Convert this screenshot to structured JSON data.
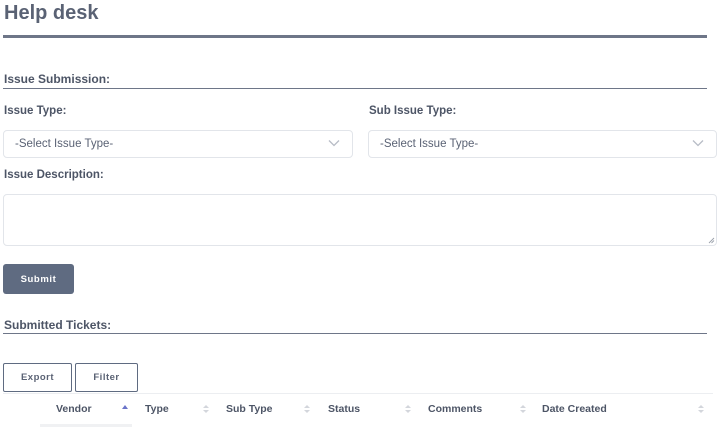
{
  "page": {
    "title": "Help desk"
  },
  "issue_submission": {
    "heading": "Issue Submission:",
    "issue_type": {
      "label": "Issue Type:",
      "selected": "-Select Issue Type-"
    },
    "sub_issue_type": {
      "label": "Sub Issue Type:",
      "selected": "-Select Issue Type-"
    },
    "description": {
      "label": "Issue Description:",
      "value": ""
    },
    "submit_label": "Submit"
  },
  "submitted_tickets": {
    "heading": "Submitted Tickets:",
    "export_label": "Export",
    "filter_label": "Filter",
    "columns": [
      {
        "label": "Vendor",
        "sort": "ascending"
      },
      {
        "label": "Type",
        "sort": "none"
      },
      {
        "label": "Sub Type",
        "sort": "none"
      },
      {
        "label": "Status",
        "sort": "none"
      },
      {
        "label": "Comments",
        "sort": "none"
      },
      {
        "label": "Date Created",
        "sort": "none"
      }
    ]
  },
  "colors": {
    "primary_button": "#5f6b81",
    "rule": "#6e7688",
    "sort_active": "#6b74c9"
  },
  "icons": {
    "select_arrow": "chevron-down-icon",
    "sort": "sort-icon",
    "sort_active": "sort-ascending-icon"
  }
}
